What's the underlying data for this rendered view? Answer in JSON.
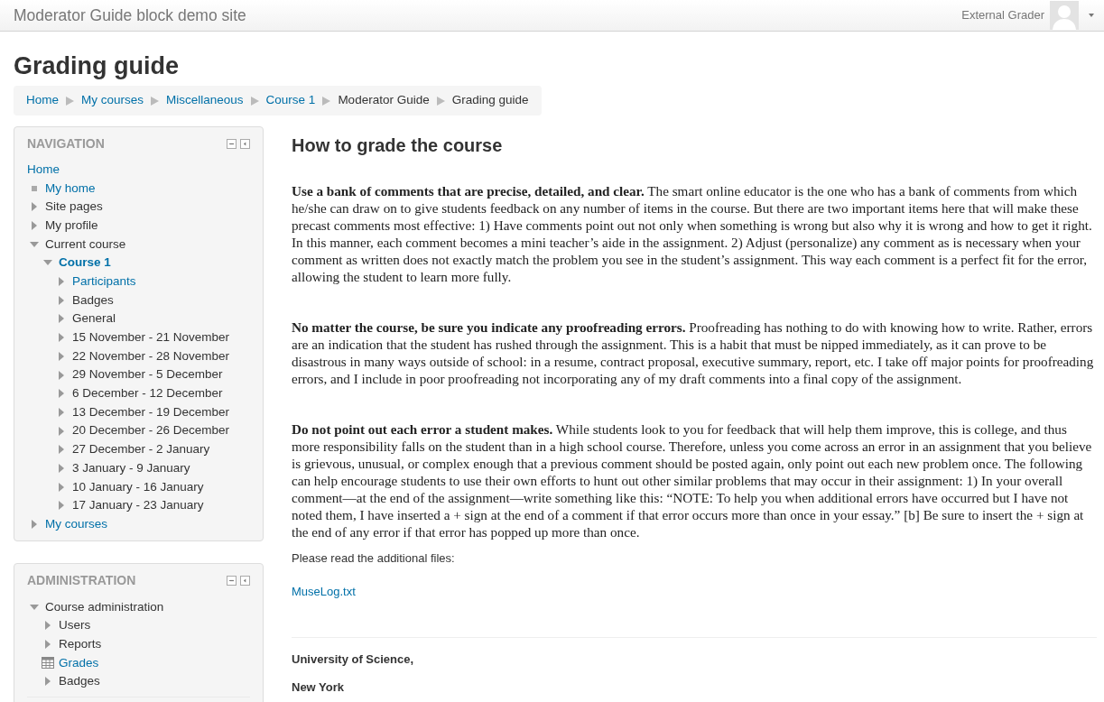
{
  "navbar": {
    "brand": "Moderator Guide block demo site",
    "user": "External Grader"
  },
  "page_title": "Grading guide",
  "breadcrumb": [
    {
      "label": "Home",
      "link": true
    },
    {
      "label": "My courses",
      "link": true
    },
    {
      "label": "Miscellaneous",
      "link": true
    },
    {
      "label": "Course 1",
      "link": true
    },
    {
      "label": "Moderator Guide",
      "link": false
    },
    {
      "label": "Grading guide",
      "link": false
    }
  ],
  "navigation": {
    "title": "NAVIGATION",
    "items": [
      {
        "label": "Home",
        "kind": "none",
        "link": true
      },
      {
        "label": "My home",
        "kind": "bullet",
        "link": true
      },
      {
        "label": "Site pages",
        "kind": "branch",
        "expanded": false,
        "link": false
      },
      {
        "label": "My profile",
        "kind": "branch",
        "expanded": false,
        "link": false
      },
      {
        "label": "Current course",
        "kind": "branch",
        "expanded": true,
        "link": false,
        "children": [
          {
            "label": "Course 1",
            "kind": "branch",
            "expanded": true,
            "link": true,
            "bold": true,
            "children": [
              {
                "label": "Participants",
                "kind": "branch",
                "expanded": false,
                "link": true
              },
              {
                "label": "Badges",
                "kind": "branch",
                "expanded": false,
                "link": false
              },
              {
                "label": "General",
                "kind": "branch",
                "expanded": false,
                "link": false
              },
              {
                "label": "15 November - 21 November",
                "kind": "branch",
                "expanded": false,
                "link": false
              },
              {
                "label": "22 November - 28 November",
                "kind": "branch",
                "expanded": false,
                "link": false
              },
              {
                "label": "29 November - 5 December",
                "kind": "branch",
                "expanded": false,
                "link": false
              },
              {
                "label": "6 December - 12 December",
                "kind": "branch",
                "expanded": false,
                "link": false
              },
              {
                "label": "13 December - 19 December",
                "kind": "branch",
                "expanded": false,
                "link": false
              },
              {
                "label": "20 December - 26 December",
                "kind": "branch",
                "expanded": false,
                "link": false
              },
              {
                "label": "27 December - 2 January",
                "kind": "branch",
                "expanded": false,
                "link": false
              },
              {
                "label": "3 January - 9 January",
                "kind": "branch",
                "expanded": false,
                "link": false
              },
              {
                "label": "10 January - 16 January",
                "kind": "branch",
                "expanded": false,
                "link": false
              },
              {
                "label": "17 January - 23 January",
                "kind": "branch",
                "expanded": false,
                "link": false
              }
            ]
          }
        ]
      },
      {
        "label": "My courses",
        "kind": "branch",
        "expanded": false,
        "link": true
      }
    ]
  },
  "administration": {
    "title": "ADMINISTRATION",
    "items": [
      {
        "label": "Course administration",
        "kind": "branch",
        "expanded": true,
        "link": false,
        "children": [
          {
            "label": "Users",
            "kind": "branch",
            "expanded": false,
            "link": false
          },
          {
            "label": "Reports",
            "kind": "branch",
            "expanded": false,
            "link": false
          },
          {
            "label": "Grades",
            "kind": "table",
            "link": true
          },
          {
            "label": "Badges",
            "kind": "branch",
            "expanded": false,
            "link": false
          }
        ]
      }
    ]
  },
  "content": {
    "heading": "How to grade the course",
    "paragraphs": [
      "**Use a bank of comments that are precise, detailed, and clear.** The smart online educator is the one who has a bank of comments from which he/she can draw on to give students feedback on any number of items in the course. But there are two important items here that will make these precast comments most effective: 1) Have comments point out not only when something is wrong but also why it is wrong and how to get it right. In this manner, each comment becomes a mini teacher’s aide in the assignment. 2) Adjust (personalize) any comment as is necessary when your comment as written does not exactly match the problem you see in the student’s assignment. This way each comment is a perfect fit for the error, allowing the student to learn more fully.",
      "**No matter the course, be sure you indicate any proofreading errors.** Proofreading has nothing to do with knowing how to write. Rather, errors are an indication that the student has rushed through the assignment. This is a habit that must be nipped immediately, as it can prove to be disastrous in many ways outside of school: in a resume, contract proposal, executive summary, report, etc. I take off major points for proofreading errors, and I include in poor proofreading not incorporating any of my draft comments into a final copy of the assignment.",
      "**Do not point out each error a student makes.** While students look to you for feedback that will help them improve, this is college, and thus more responsibility falls on the student than in a high school course. Therefore, unless you come across an error in an assignment that you believe is grievous, unusual, or complex enough that a previous comment should be posted again, only point out each new problem once. The following can help encourage students to use their own efforts to hunt out other similar problems that may occur in their assignment: 1) In your overall comment—at the end of the assignment—write something like this: “NOTE: To help you when additional errors have occurred but I have not noted them, I have inserted a + sign at the end of a comment if that error occurs more than once in your essay.” [b] Be sure to insert the + sign at the end of any error if that error has popped up more than once."
    ],
    "files_note": "Please read the additional files:",
    "file": "MuseLog.txt",
    "footer_lines": [
      "University of Science,",
      "New York"
    ]
  }
}
